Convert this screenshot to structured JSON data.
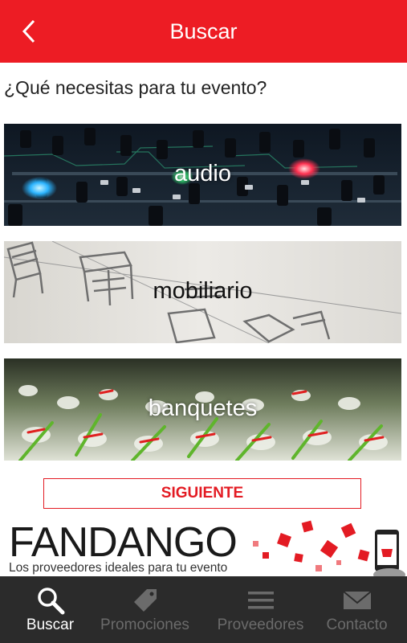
{
  "header": {
    "title": "Buscar",
    "back_icon": "chevron-left-icon",
    "color": "#ed1c24"
  },
  "question": "¿Qué necesitas para tu evento?",
  "categories": [
    {
      "label": "audio"
    },
    {
      "label": "mobiliario"
    },
    {
      "label": "banquetes"
    }
  ],
  "next_button": "SIGUIENTE",
  "banner": {
    "brand": "FANDANGO",
    "tagline": "Los proveedores ideales para tu evento"
  },
  "tabs": [
    {
      "label": "Buscar",
      "icon": "search-icon",
      "active": true
    },
    {
      "label": "Promociones",
      "icon": "tag-icon",
      "active": false
    },
    {
      "label": "Proveedores",
      "icon": "menu-icon",
      "active": false
    },
    {
      "label": "Contacto",
      "icon": "mail-icon",
      "active": false
    }
  ]
}
